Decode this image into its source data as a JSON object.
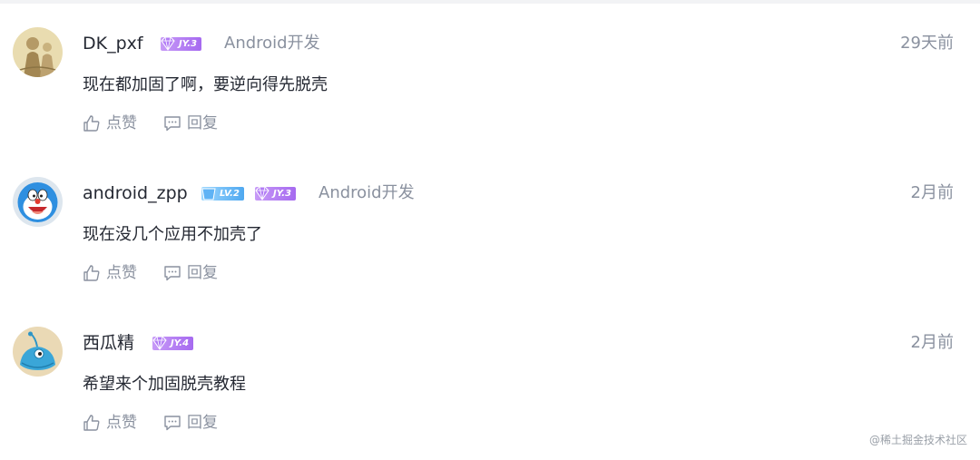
{
  "comments": [
    {
      "user": "DK_pxf",
      "badges": [
        "JY.3"
      ],
      "job": "Android开发",
      "time": "29天前",
      "content": "现在都加固了啊，要逆向得先脱壳",
      "like_label": "点赞",
      "reply_label": "回复"
    },
    {
      "user": "android_zpp",
      "badges": [
        "LV.2",
        "JY.3"
      ],
      "job": "Android开发",
      "time": "2月前",
      "content": "现在没几个应用不加壳了",
      "like_label": "点赞",
      "reply_label": "回复"
    },
    {
      "user": "西瓜精",
      "badges": [
        "JY.4"
      ],
      "job": "",
      "time": "2月前",
      "content": "希望来个加固脱壳教程",
      "like_label": "点赞",
      "reply_label": "回复"
    }
  ],
  "watermark": "@稀土掘金技术社区",
  "icons": {
    "like": "thumbs-up-icon",
    "reply": "comment-bubble-icon",
    "jy_badge": "diamond-gem-icon",
    "lv_badge": "level-badge-icon"
  },
  "colors": {
    "text_primary": "#252933",
    "text_secondary": "#8a919f",
    "badge_jy": "#a66af0",
    "badge_lv": "#4fa8f0"
  }
}
